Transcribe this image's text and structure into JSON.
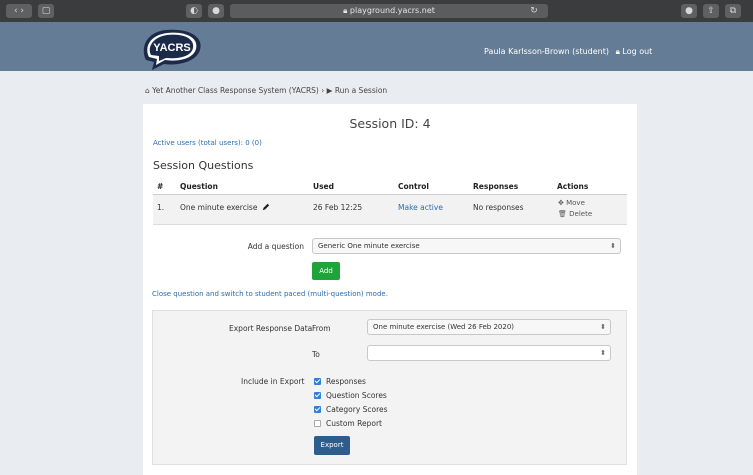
{
  "browser": {
    "url": "playground.yacrs.net"
  },
  "header": {
    "logo_text": "YACRS",
    "user_name": "Paula Karlsson-Brown (student)",
    "logout_label": "Log out"
  },
  "breadcrumb": {
    "home": "Yet Another Class Response System (YACRS)",
    "separator": "›",
    "current": "Run a Session"
  },
  "session": {
    "title": "Session ID: 4",
    "active_users": "Active users (total users): 0 (0)",
    "questions_heading": "Session Questions"
  },
  "table": {
    "headers": [
      "#",
      "Question",
      "Used",
      "Control",
      "Responses",
      "Actions"
    ],
    "rows": [
      {
        "num": "1.",
        "question": "One minute exercise",
        "used": "26 Feb 12:25",
        "control": "Make active",
        "responses": "No responses",
        "move": "Move",
        "delete": "Delete"
      }
    ]
  },
  "add_question": {
    "label": "Add a question",
    "selected": "Generic One minute exercise",
    "button": "Add"
  },
  "switch_mode_link": "Close question and switch to student paced (multi-question) mode.",
  "export": {
    "label": "Export Response Data",
    "from_label": "From",
    "from_value": "One minute exercise (Wed 26 Feb 2020)",
    "to_label": "To",
    "to_value": "",
    "include_label": "Include in Export",
    "options": [
      {
        "label": "Responses",
        "checked": true
      },
      {
        "label": "Question Scores",
        "checked": true
      },
      {
        "label": "Category Scores",
        "checked": true
      },
      {
        "label": "Custom Report",
        "checked": false
      }
    ],
    "button": "Export"
  },
  "colors": {
    "header_bg": "#647c95",
    "link": "#2b6cb0",
    "add_button": "#1fa43b",
    "export_button": "#2e5d8c",
    "checkbox": "#2f7fe0"
  }
}
